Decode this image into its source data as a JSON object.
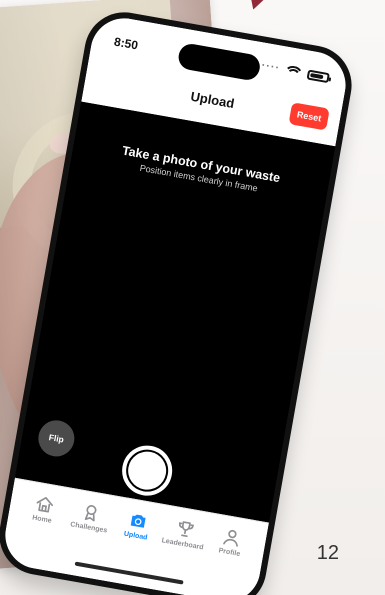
{
  "slide": {
    "page_number": "12"
  },
  "status_bar": {
    "time": "8:50",
    "battery_fraction": 0.82
  },
  "nav": {
    "title": "Upload",
    "reset_label": "Reset"
  },
  "camera": {
    "title": "Take a photo of your waste",
    "subtitle": "Position items clearly in frame",
    "flip_label": "Flip"
  },
  "tabs": [
    {
      "label": "Home",
      "icon": "home-icon"
    },
    {
      "label": "Challenges",
      "icon": "badge-icon"
    },
    {
      "label": "Upload",
      "icon": "camera-icon"
    },
    {
      "label": "Leaderboard",
      "icon": "trophy-icon"
    },
    {
      "label": "Profile",
      "icon": "profile-icon"
    }
  ],
  "colors": {
    "accent_blue": "#0a84ff",
    "danger_red": "#ff3b30",
    "arrow_maroon": "#8b1e2d"
  }
}
